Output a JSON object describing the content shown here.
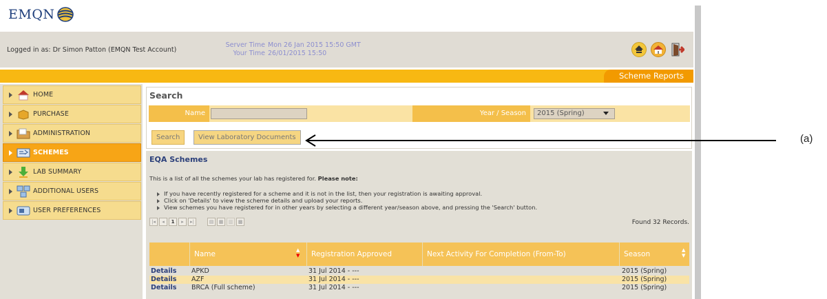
{
  "logo": {
    "text": "EMQN"
  },
  "header": {
    "logged_in": "Logged in as: Dr Simon Patton (EMQN Test Account)",
    "server_time_label": "Server Time",
    "your_time_label": "Your Time",
    "server_time": "Mon 26 Jan 2015 15:50 GMT",
    "your_time": "26/01/2015 15:50",
    "icons": [
      "home-icon",
      "home-alt-icon",
      "logout-icon"
    ]
  },
  "section_tab": "Scheme Reports",
  "sidebar": {
    "items": [
      {
        "label": "HOME",
        "icon": "home-icon"
      },
      {
        "label": "PURCHASE",
        "icon": "box-icon"
      },
      {
        "label": "ADMINISTRATION",
        "icon": "folder-icon"
      },
      {
        "label": "SCHEMES",
        "icon": "schemes-icon",
        "active": true
      },
      {
        "label": "LAB SUMMARY",
        "icon": "download-icon"
      },
      {
        "label": "ADDITIONAL USERS",
        "icon": "users-icon"
      },
      {
        "label": "USER PREFERENCES",
        "icon": "preferences-icon"
      }
    ]
  },
  "search": {
    "title": "Search",
    "name_label": "Name",
    "name_value": "",
    "year_label": "Year / Season",
    "year_value": "2015 (Spring)",
    "search_button": "Search",
    "docs_button": "View Laboratory Documents"
  },
  "schemes": {
    "title": "EQA Schemes",
    "intro": "This is a list of all the schemes your lab has registered for.",
    "intro_bold": "Please note:",
    "notes": [
      "If you have recently registered for a scheme and it is not in the list, then your registration is awaiting approval.",
      "Click on 'Details' to view the scheme details and upload your reports.",
      "View schemes you have registered for in other years by selecting a different year/season above, and pressing the 'Search' button."
    ],
    "pager": {
      "current_page": "1"
    },
    "found": "Found 32 Records.",
    "columns": [
      "Name",
      "Registration Approved",
      "Next Activity For Completion (From-To)",
      "Season"
    ],
    "details_label": "Details",
    "rows": [
      {
        "name": "APKD",
        "approved": "31 Jul 2014 - ---",
        "next": "",
        "season": "2015 (Spring)"
      },
      {
        "name": "AZF",
        "approved": "31 Jul 2014 - ---",
        "next": "",
        "season": "2015 (Spring)"
      },
      {
        "name": "BRCA (Full scheme)",
        "approved": "31 Jul 2014 - ---",
        "next": "",
        "season": "2015 (Spring)"
      }
    ]
  },
  "annotation": {
    "label": "(a)"
  },
  "colors": {
    "orange": "#f8b812",
    "tab_orange": "#f29a00",
    "header_bg": "#e0dcd4",
    "link_blue": "#2b3f7a"
  }
}
